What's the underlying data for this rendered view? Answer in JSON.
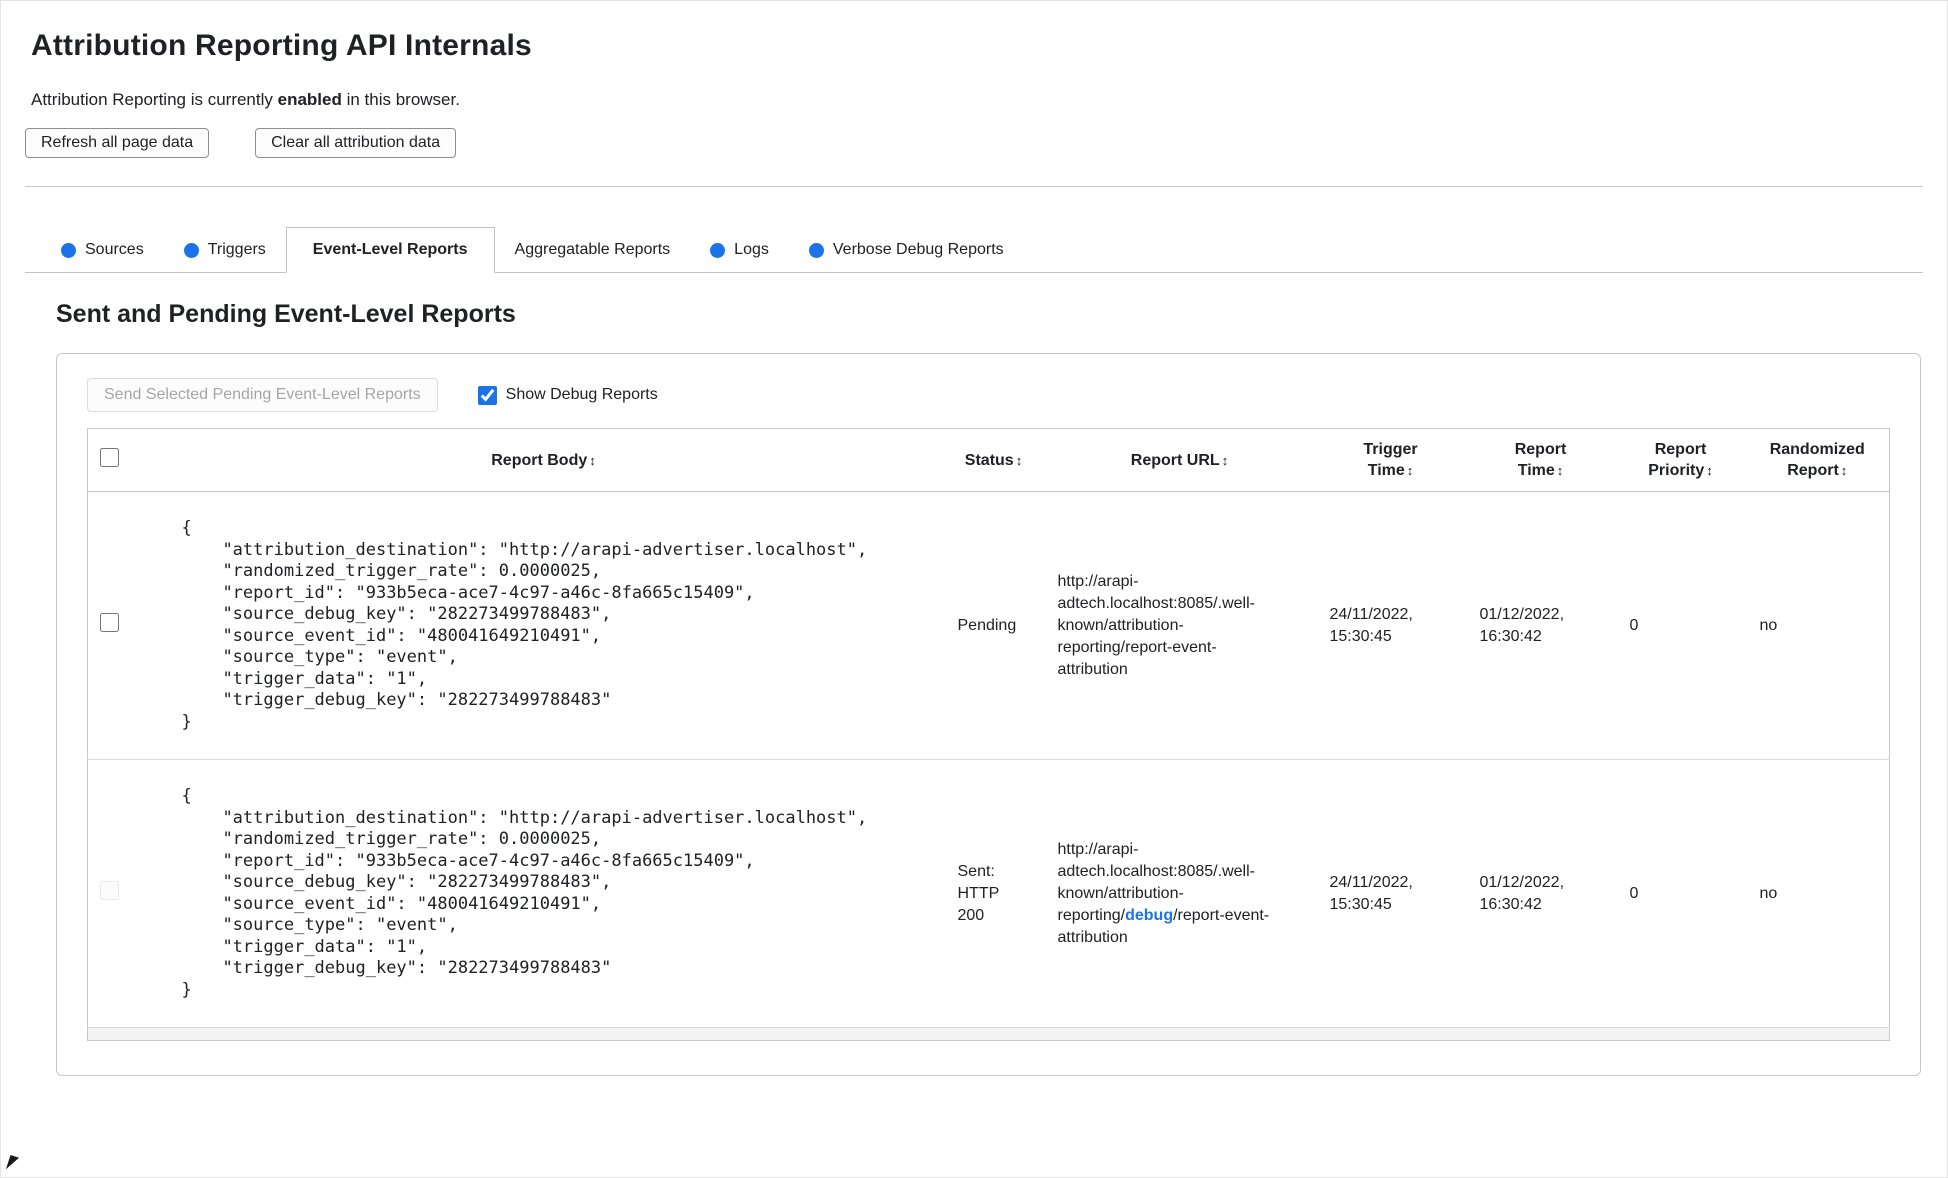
{
  "colors": {
    "accent_blue": "#1a73e8",
    "text": "#202124",
    "border": "#c8c8c8",
    "disabled_text": "#a6a6a6"
  },
  "header": {
    "title": "Attribution Reporting API Internals",
    "status_prefix": "Attribution Reporting is currently ",
    "status_bold": "enabled",
    "status_suffix": " in this browser."
  },
  "toolbar": {
    "refresh_label": "Refresh all page data",
    "clear_label": "Clear all attribution data"
  },
  "tabs": [
    {
      "label": "Sources",
      "has_dot": true,
      "active": false
    },
    {
      "label": "Triggers",
      "has_dot": true,
      "active": false
    },
    {
      "label": "Event-Level Reports",
      "has_dot": false,
      "active": true
    },
    {
      "label": "Aggregatable Reports",
      "has_dot": false,
      "active": false
    },
    {
      "label": "Logs",
      "has_dot": true,
      "active": false
    },
    {
      "label": "Verbose Debug Reports",
      "has_dot": true,
      "active": false
    }
  ],
  "section": {
    "title": "Sent and Pending Event-Level Reports"
  },
  "panel": {
    "send_button_label": "Send Selected Pending Event-Level Reports",
    "send_button_enabled": false,
    "show_debug_label": "Show Debug Reports",
    "show_debug_checked": true
  },
  "table": {
    "sort_icon": "↕",
    "columns": [
      {
        "label": "Report Body"
      },
      {
        "label": "Status"
      },
      {
        "label": "Report URL"
      },
      {
        "label": "Trigger Time"
      },
      {
        "label": "Report Time"
      },
      {
        "label": "Report Priority"
      },
      {
        "label": "Randomized Report"
      }
    ],
    "rows": [
      {
        "selected": false,
        "checkbox_enabled": true,
        "report_body": "{\n    \"attribution_destination\": \"http://arapi-advertiser.localhost\",\n    \"randomized_trigger_rate\": 0.0000025,\n    \"report_id\": \"933b5eca-ace7-4c97-a46c-8fa665c15409\",\n    \"source_debug_key\": \"282273499788483\",\n    \"source_event_id\": \"480041649210491\",\n    \"source_type\": \"event\",\n    \"trigger_data\": \"1\",\n    \"trigger_debug_key\": \"282273499788483\"\n}",
        "status": "Pending",
        "report_url": "http://arapi-adtech.localhost:8085/.well-known/attribution-reporting/report-event-attribution",
        "trigger_time": "24/11/2022, 15:30:45",
        "report_time": "01/12/2022, 16:30:42",
        "report_priority": "0",
        "randomized_report": "no"
      },
      {
        "selected": false,
        "checkbox_enabled": false,
        "report_body": "{\n    \"attribution_destination\": \"http://arapi-advertiser.localhost\",\n    \"randomized_trigger_rate\": 0.0000025,\n    \"report_id\": \"933b5eca-ace7-4c97-a46c-8fa665c15409\",\n    \"source_debug_key\": \"282273499788483\",\n    \"source_event_id\": \"480041649210491\",\n    \"source_type\": \"event\",\n    \"trigger_data\": \"1\",\n    \"trigger_debug_key\": \"282273499788483\"\n}",
        "status": "Sent: HTTP 200",
        "report_url_prefix": "http://arapi-adtech.localhost:8085/.well-known/attribution-reporting/",
        "report_url_debug": "debug",
        "report_url_suffix": "/report-event-attribution",
        "trigger_time": "24/11/2022, 15:30:45",
        "report_time": "01/12/2022, 16:30:42",
        "report_priority": "0",
        "randomized_report": "no"
      }
    ]
  }
}
